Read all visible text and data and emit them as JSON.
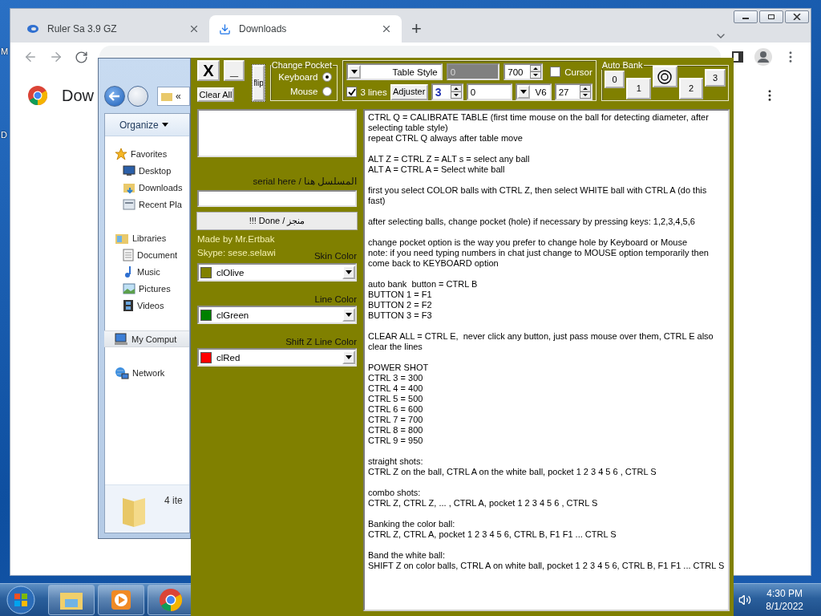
{
  "desktop": {
    "labels": [
      "M",
      "D"
    ]
  },
  "browser": {
    "tabs": [
      {
        "title": "Ruler Sa 3.9 GZ",
        "selected": false
      },
      {
        "title": "Downloads",
        "selected": true
      }
    ],
    "new_tab": "+",
    "page_heading": "Dow"
  },
  "explorer": {
    "address": "«",
    "toolbar": "Organize",
    "nav": [
      {
        "label": "Favorites",
        "selected": false,
        "children": [
          {
            "label": "Desktop",
            "selected": false
          },
          {
            "label": "Downloads",
            "selected": false
          },
          {
            "label": "Recent Pla",
            "selected": false
          }
        ]
      },
      {
        "label": "Libraries",
        "selected": false,
        "children": [
          {
            "label": "Document",
            "selected": false
          },
          {
            "label": "Music",
            "selected": false
          },
          {
            "label": "Pictures",
            "selected": false
          },
          {
            "label": "Videos",
            "selected": false
          }
        ]
      },
      {
        "label": "My Comput",
        "selected": true
      },
      {
        "label": "Network",
        "selected": false
      }
    ],
    "status": "4 ite"
  },
  "tool": {
    "close": "X",
    "minimize": "_",
    "clear": "Clear All",
    "flip": "flip",
    "pocket": {
      "title": "Change Pocket",
      "options": [
        {
          "label": "Keyboard",
          "selected": true
        },
        {
          "label": "Mouse",
          "selected": false
        }
      ]
    },
    "table_style": "Table Style",
    "gray_value": "0",
    "spin_1": "700",
    "cursor": {
      "label": "Cursor",
      "checked": false
    },
    "lines": {
      "label": "3 lines",
      "checked": true
    },
    "adjuster": "Adjuster",
    "spin_2": "3",
    "field_value": "0",
    "version": "V6",
    "spin_3": "27",
    "auto_bank": {
      "title": "Auto Bank",
      "buttons": [
        "0",
        "1",
        "2",
        "3"
      ]
    },
    "serial_label": "serial here / المسلسل هنا",
    "done": "!!! Done / منجز",
    "credit": "Made by Mr.Ertbak",
    "skype": "Skype: sese.selawi",
    "colors": [
      {
        "label": "Skin Color",
        "value": "clOlive",
        "color": "#808000"
      },
      {
        "label": "Line Color",
        "value": "clGreen",
        "color": "#008000"
      },
      {
        "label": "Shift Z Line Color",
        "value": "clRed",
        "color": "#ff0000"
      }
    ],
    "help": [
      [
        "CTRL Q = CALIBRATE TABLE (first time mouse on the ball for detecting diameter, after selecting table style)",
        "repeat CTRL Q always after table move"
      ],
      [
        "ALT Z = CTRL Z = ALT s = select any ball",
        "ALT A = CTRL A = Select white ball"
      ],
      [
        "first you select COLOR balls with CTRL Z, then select WHITE ball with CTRL A (do this fast)"
      ],
      [
        "after selecting balls, change pocket (hole) if necessary by pressing keys: 1,2,3,4,5,6"
      ],
      [
        "change pocket option is the way you prefer to change hole by Keyboard or Mouse",
        "note: if you need typing numbers in chat just change to MOUSE option temporarily then come back to KEYBOARD option"
      ],
      [
        "auto bank  button = CTRL B",
        "BUTTON 1 = F1",
        "BUTTON 2 = F2",
        "BUTTON 3 = F3"
      ],
      [
        "CLEAR ALL = CTRL E,  never click any button, just pass mouse over them, CTRL E also clear the lines"
      ],
      [
        "POWER SHOT",
        "CTRL 3 = 300",
        "CTRL 4 = 400",
        "CTRL 5 = 500",
        "CTRL 6 = 600",
        "CTRL 7 = 700",
        "CTRL 8 = 800",
        "CTRL 9 = 950"
      ],
      [
        "straight shots:",
        "CTRL Z on the ball, CTRL A on the white ball, pocket 1 2 3 4 5 6 , CTRL S"
      ],
      [
        "combo shots:",
        "CTRL Z, CTRL Z, ... , CTRL A, pocket 1 2 3 4 5 6 , CTRL S"
      ],
      [
        "Banking the color ball:",
        "CTRL Z, CTRL A, pocket 1 2 3 4 5 6, CTRL B, F1 F1 ... CTRL S"
      ],
      [
        "Band the white ball:",
        "SHIFT Z on color balls, CTRL A on white ball, pocket 1 2 3 4 5 6, CTRL B, F1 F1 ... CTRL S"
      ]
    ]
  },
  "taskbar": {
    "time": "4:30 PM",
    "date": "8/1/2022"
  }
}
